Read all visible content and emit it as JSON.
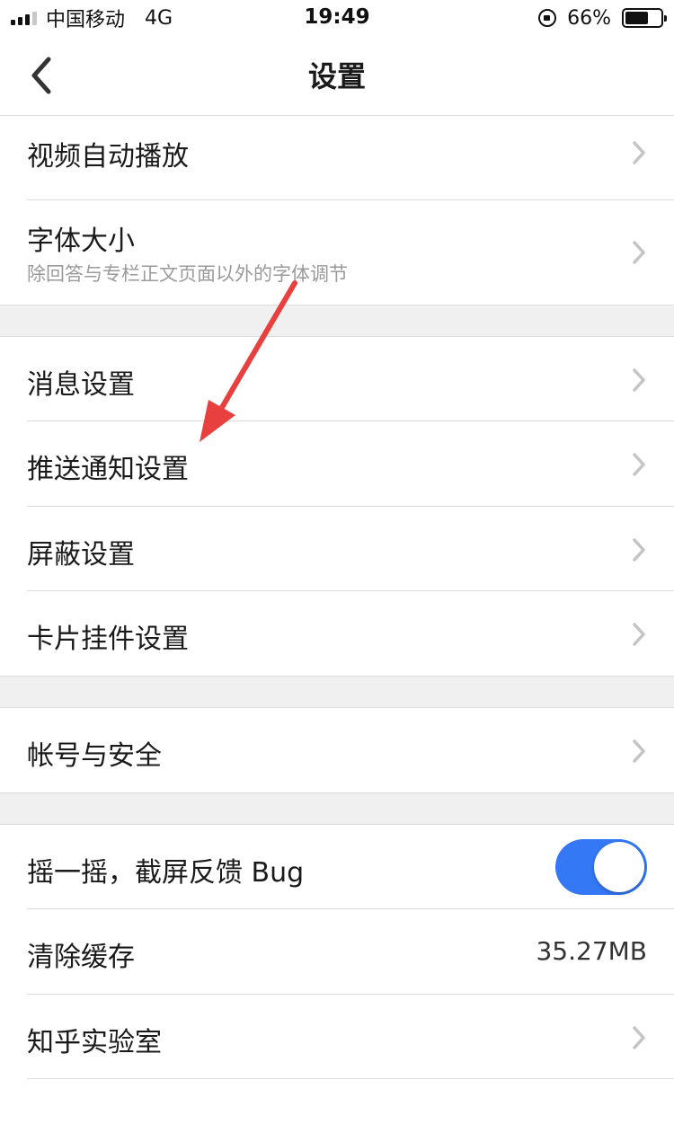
{
  "status_bar": {
    "carrier": "中国移动",
    "network": "4G",
    "time": "19:49",
    "battery_percent": "66%",
    "battery_level": 0.66
  },
  "nav": {
    "title": "设置",
    "back_icon": "chevron-left-icon"
  },
  "settings": {
    "video_autoplay": "视频自动播放",
    "font_size": {
      "label": "字体大小",
      "sub": "除回答与专栏正文页面以外的字体调节"
    },
    "message_settings": "消息设置",
    "push_settings": "推送通知设置",
    "block_settings": "屏蔽设置",
    "widget_settings": "卡片挂件设置",
    "account_security": "帐号与安全",
    "shake_feedback": {
      "label": "摇一摇，截屏反馈 Bug",
      "enabled": true
    },
    "clear_cache": {
      "label": "清除缓存",
      "value": "35.27MB"
    },
    "lab": "知乎实验室"
  },
  "colors": {
    "toggle_on": "#3478f6",
    "annotation_arrow": "#e8403f"
  }
}
